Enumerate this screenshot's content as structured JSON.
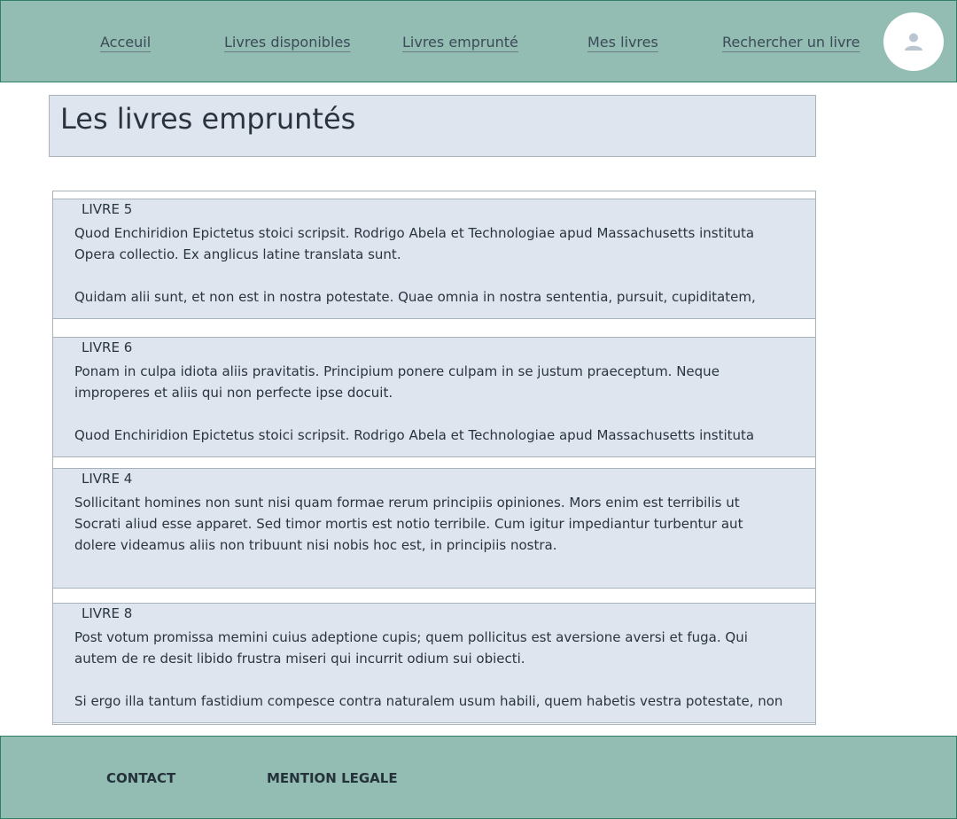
{
  "nav": {
    "items": [
      {
        "label": "Acceuil"
      },
      {
        "label": "Livres disponibles"
      },
      {
        "label": "Livres emprunté"
      },
      {
        "label": "Mes livres"
      },
      {
        "label": "Rechercher un livre"
      }
    ],
    "avatar_icon": "user-icon"
  },
  "page": {
    "title": "Les livres empruntés"
  },
  "books": [
    {
      "title": "LIVRE 5",
      "text": "Quod Enchiridion Epictetus stoici scripsit. Rodrigo Abela et Technologiae apud Massachusetts instituta Opera collectio. Ex anglicus latine translata sunt.\n\nQuidam alii sunt, et non est in nostra potestate. Quae omnia in nostra sententia, pursuit, cupiditatem,"
    },
    {
      "title": "LIVRE 6",
      "text": "Ponam in culpa idiota aliis pravitatis. Principium ponere culpam in se justum praeceptum. Neque improperes et aliis qui non perfecte ipse docuit.\n\nQuod Enchiridion Epictetus stoici scripsit. Rodrigo Abela et Technologiae apud Massachusetts instituta"
    },
    {
      "title": "LIVRE 4",
      "text": "Sollicitant homines non sunt nisi quam formae rerum principiis opiniones. Mors enim est terribilis ut Socrati aliud esse apparet. Sed timor mortis est notio terribile. Cum igitur impediantur turbentur aut dolere videamus aliis non tribuunt nisi nobis hoc est, in principiis nostra."
    },
    {
      "title": "LIVRE 8",
      "text": "Post votum promissa memini cuius adeptione cupis; quem pollicitus est aversione aversi et fuga. Qui autem de re desit libido frustra miseri qui incurrit odium sui obiecti.\n\nSi ergo illa tantum fastidium compesce contra naturalem usum habili, quem habetis vestra potestate, non"
    }
  ],
  "footer": {
    "contact": "CONTACT",
    "legal": "MENTION LEGALE"
  },
  "colors": {
    "header_bg": "#93bcb2",
    "header_border": "#2f7f66",
    "card_bg": "#dfe5ee",
    "card_border": "#a6b2bc",
    "text": "#2a3440"
  }
}
